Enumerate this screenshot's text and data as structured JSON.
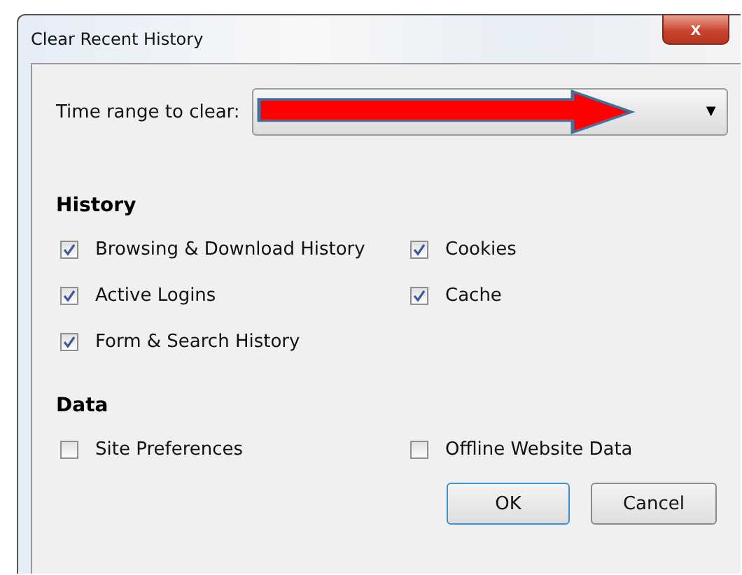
{
  "window": {
    "title": "Clear Recent History",
    "close": "x"
  },
  "time_range": {
    "label": "Time range to clear:",
    "caret": "▼"
  },
  "sections": [
    {
      "title": "History",
      "options": [
        {
          "label": "Browsing & Download History",
          "checked": true
        },
        {
          "label": "Cookies",
          "checked": true
        },
        {
          "label": "Active Logins",
          "checked": true
        },
        {
          "label": "Cache",
          "checked": true
        },
        {
          "label": "Form & Search History",
          "checked": true
        }
      ]
    },
    {
      "title": "Data",
      "options": [
        {
          "label": "Site Preferences",
          "checked": false
        },
        {
          "label": "Offline Website Data",
          "checked": false
        }
      ]
    }
  ],
  "buttons": [
    {
      "label": "OK",
      "default": true
    },
    {
      "label": "Cancel",
      "default": false
    }
  ]
}
